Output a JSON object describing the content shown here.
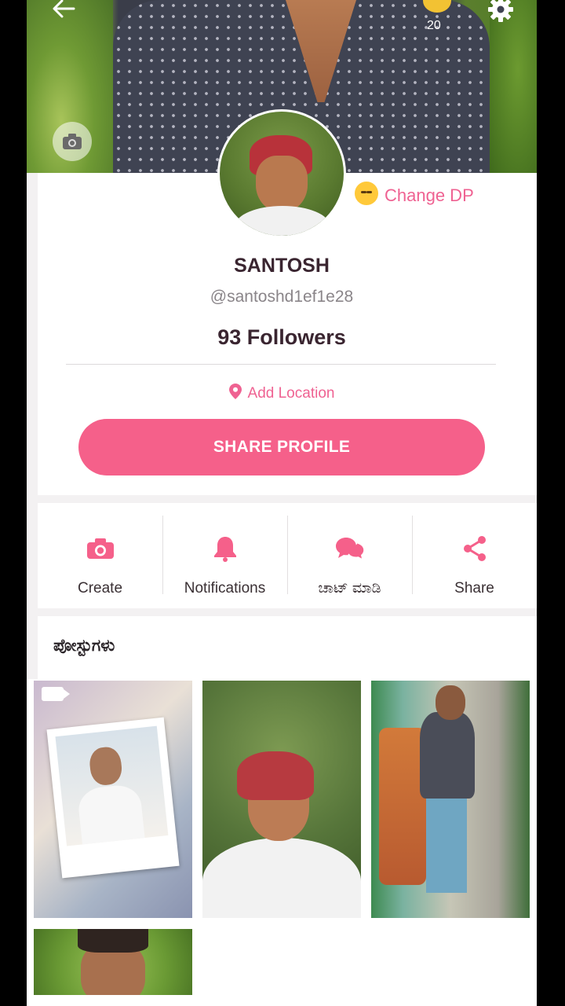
{
  "header": {
    "coin_count": "20"
  },
  "profile": {
    "change_dp_label": "Change DP",
    "name": "SANTOSH",
    "handle": "@santoshd1ef1e28",
    "followers": "93 Followers",
    "location_label": "Add Location",
    "share_profile_label": "SHARE PROFILE"
  },
  "actions": [
    {
      "label": "Create",
      "icon": "camera-icon"
    },
    {
      "label": "Notifications",
      "icon": "bell-icon"
    },
    {
      "label": "ಚಾಟ್ ಮಾಡಿ",
      "icon": "chat-icon"
    },
    {
      "label": "Share",
      "icon": "share-icon"
    }
  ],
  "posts": {
    "title": "ಪೋಸ್ಟುಗಳು"
  },
  "colors": {
    "accent": "#f5608a",
    "accent_text": "#ef6292"
  }
}
